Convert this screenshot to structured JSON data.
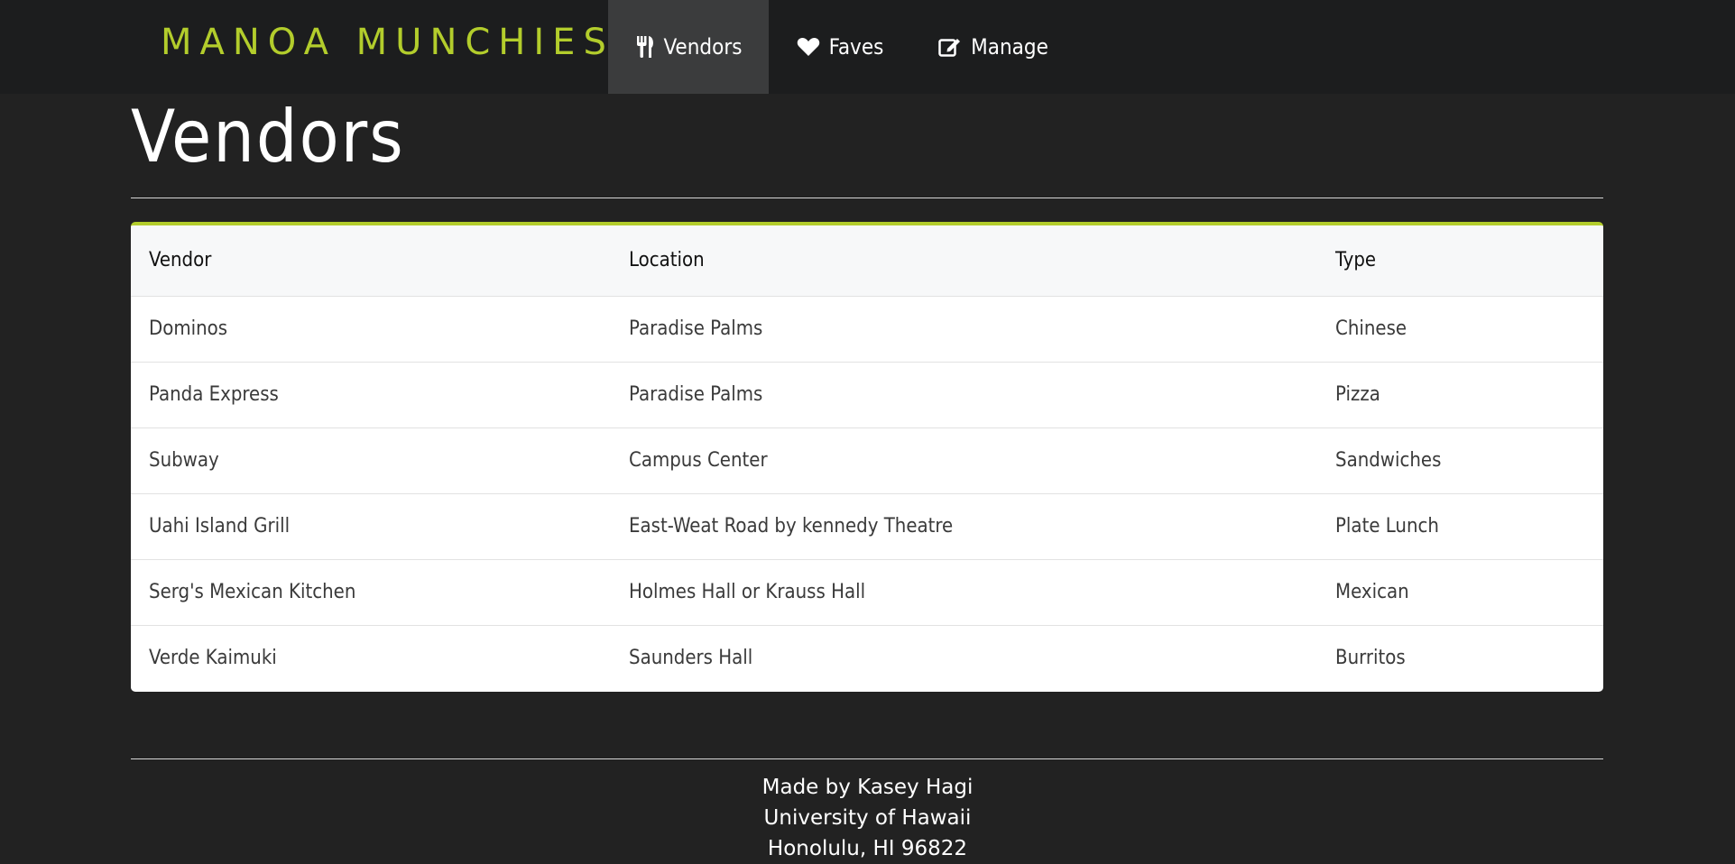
{
  "brand": {
    "name": "MANOA MUNCHIES",
    "color": "#b3cd2c"
  },
  "nav": {
    "items": [
      {
        "label": "Vendors",
        "icon": "utensils-icon",
        "active": true
      },
      {
        "label": "Faves",
        "icon": "heart-icon",
        "active": false
      },
      {
        "label": "Manage",
        "icon": "edit-icon",
        "active": false
      }
    ]
  },
  "page": {
    "title": "Vendors"
  },
  "table": {
    "headers": [
      "Vendor",
      "Location",
      "Type"
    ],
    "rows": [
      [
        "Dominos",
        "Paradise Palms",
        "Chinese"
      ],
      [
        "Panda Express",
        "Paradise Palms",
        "Pizza"
      ],
      [
        "Subway",
        "Campus Center",
        "Sandwiches"
      ],
      [
        "Uahi Island Grill",
        "East-Weat Road by kennedy Theatre",
        "Plate Lunch"
      ],
      [
        "Serg's Mexican Kitchen",
        "Holmes Hall or Krauss Hall",
        "Mexican"
      ],
      [
        "Verde Kaimuki",
        "Saunders Hall",
        "Burritos"
      ]
    ]
  },
  "footer": {
    "line1": "Made by Kasey Hagi",
    "line2": "University of Hawaii",
    "line3": "Honolulu, HI 96822"
  }
}
